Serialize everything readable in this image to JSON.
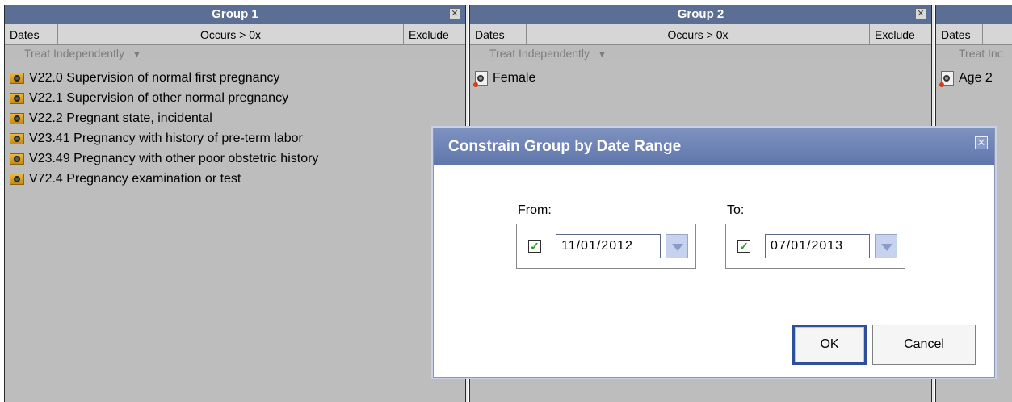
{
  "groups": [
    {
      "title": "Group 1",
      "dates_label": "Dates",
      "occurs_label": "Occurs > 0x",
      "exclude_label": "Exclude",
      "treat_label": "Treat Independently",
      "items": [
        "V22.0 Supervision of normal first pregnancy",
        "V22.1 Supervision of other normal pregnancy",
        "V22.2 Pregnant state, incidental",
        "V23.41 Pregnancy with history of pre-term labor",
        "V23.49 Pregnancy with other poor obstetric history",
        "V72.4 Pregnancy examination or test"
      ]
    },
    {
      "title": "Group 2",
      "dates_label": "Dates",
      "occurs_label": "Occurs > 0x",
      "exclude_label": "Exclude",
      "treat_label": "Treat Independently",
      "items": [
        "Female"
      ]
    },
    {
      "dates_label": "Dates",
      "treat_label": "Treat Inc",
      "items": [
        "Age 2"
      ]
    }
  ],
  "dialog": {
    "title": "Constrain Group by Date Range",
    "from_label": "From:",
    "to_label": "To:",
    "from_date": "11/01/2012",
    "to_date": "07/01/2013",
    "from_checked": true,
    "to_checked": true,
    "ok_label": "OK",
    "cancel_label": "Cancel"
  }
}
